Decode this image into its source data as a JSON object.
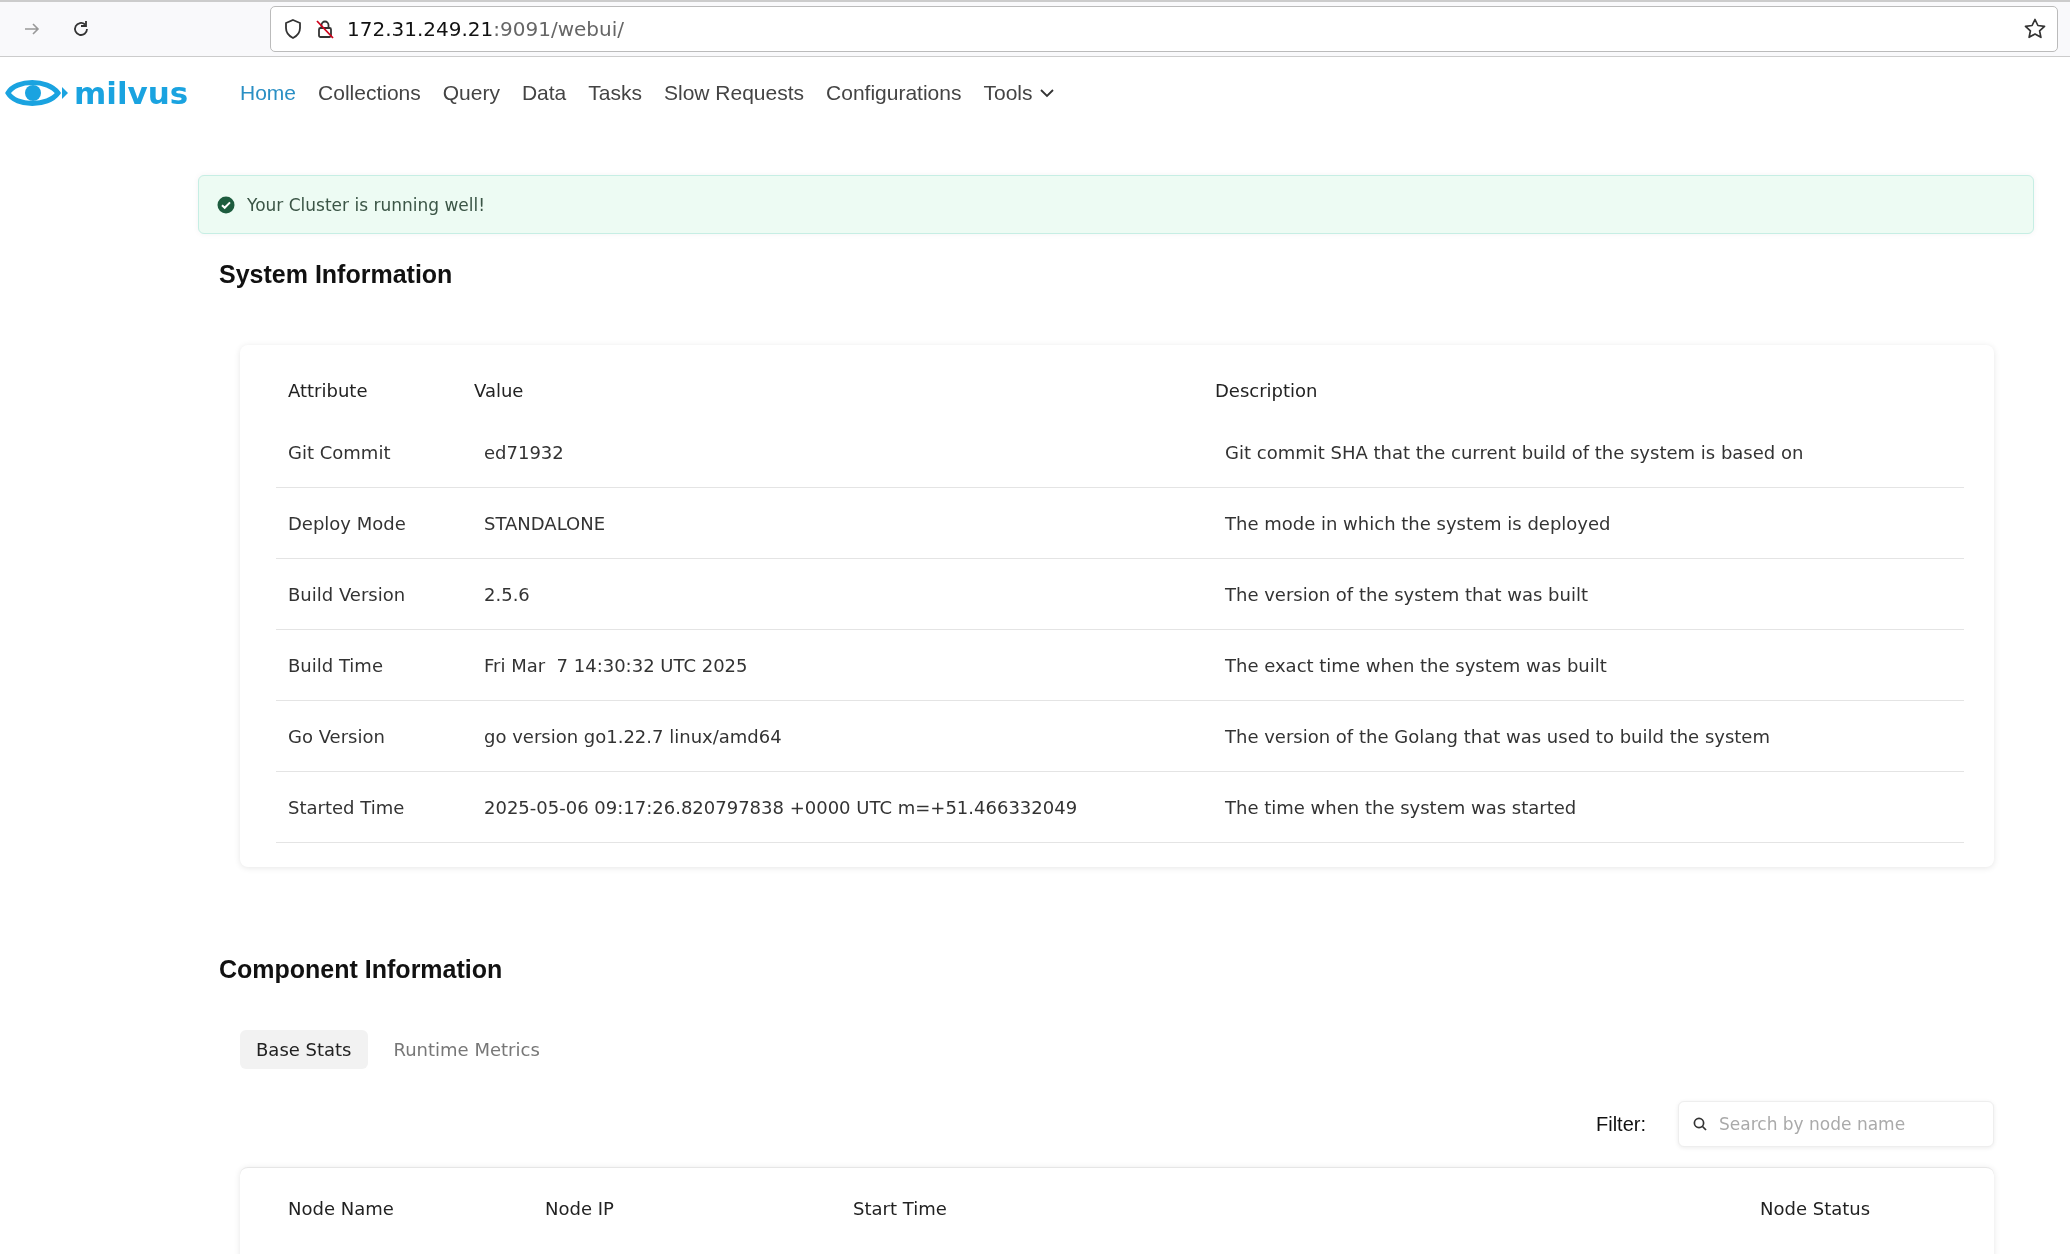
{
  "browser": {
    "url_host": "172.31.249.21",
    "url_path": ":9091/webui/"
  },
  "nav": {
    "logo": "milvus",
    "items": [
      {
        "label": "Home",
        "selected": true,
        "kind": "link"
      },
      {
        "label": "Collections",
        "selected": false,
        "kind": "link"
      },
      {
        "label": "Query",
        "selected": false,
        "kind": "link"
      },
      {
        "label": "Data",
        "selected": false,
        "kind": "link"
      },
      {
        "label": "Tasks",
        "selected": false,
        "kind": "link"
      },
      {
        "label": "Slow Requests",
        "selected": false,
        "kind": "link"
      },
      {
        "label": "Configurations",
        "selected": false,
        "kind": "link"
      },
      {
        "label": "Tools",
        "selected": false,
        "kind": "dropdown"
      }
    ]
  },
  "alert": {
    "text": "Your Cluster is running well!"
  },
  "system_information": {
    "title": "System Information",
    "columns": [
      "Attribute",
      "Value",
      "Description"
    ],
    "rows": [
      [
        "Git Commit",
        "ed71932",
        "Git commit SHA that the current build of the system is based on"
      ],
      [
        "Deploy Mode",
        "STANDALONE",
        "The mode in which the system is deployed"
      ],
      [
        "Build Version",
        "2.5.6",
        "The version of the system that was built"
      ],
      [
        "Build Time",
        "Fri Mar  7 14:30:32 UTC 2025",
        "The exact time when the system was built"
      ],
      [
        "Go Version",
        "go version go1.22.7 linux/amd64",
        "The version of the Golang that was used to build the system"
      ],
      [
        "Started Time",
        "2025-05-06 09:17:26.820797838 +0000 UTC m=+51.466332049",
        "The time when the system was started"
      ]
    ]
  },
  "component_information": {
    "title": "Component Information",
    "tabs": [
      {
        "label": "Base Stats",
        "selected": true
      },
      {
        "label": "Runtime Metrics",
        "selected": false
      }
    ],
    "filter": {
      "label": "Filter:",
      "placeholder": "Search by node name"
    },
    "columns": [
      "Node Name",
      "Node IP",
      "Start Time",
      "Node Status"
    ]
  }
}
